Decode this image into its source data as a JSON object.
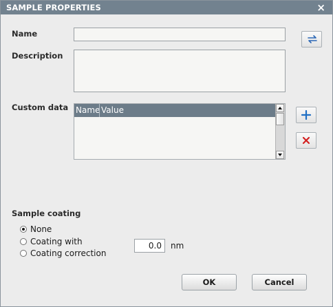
{
  "dialog": {
    "title": "SAMPLE PROPERTIES",
    "close_icon": "×"
  },
  "fields": {
    "name_label": "Name",
    "name_value": "",
    "description_label": "Description",
    "description_value": ""
  },
  "custom_data": {
    "label": "Custom data",
    "columns": [
      "Name",
      "Value"
    ],
    "rows": []
  },
  "icons": {
    "swap": "swap-arrows-icon",
    "add": "plus-icon",
    "delete": "x-delete-icon",
    "add_color": "#1f6fc4",
    "delete_color": "#d32020"
  },
  "coating": {
    "label": "Sample coating",
    "options": [
      {
        "label": "None",
        "selected": true
      },
      {
        "label": "Coating with",
        "selected": false
      },
      {
        "label": "Coating correction",
        "selected": false
      }
    ],
    "thickness_value": "0.0",
    "unit": "nm"
  },
  "buttons": {
    "ok": "OK",
    "cancel": "Cancel"
  }
}
